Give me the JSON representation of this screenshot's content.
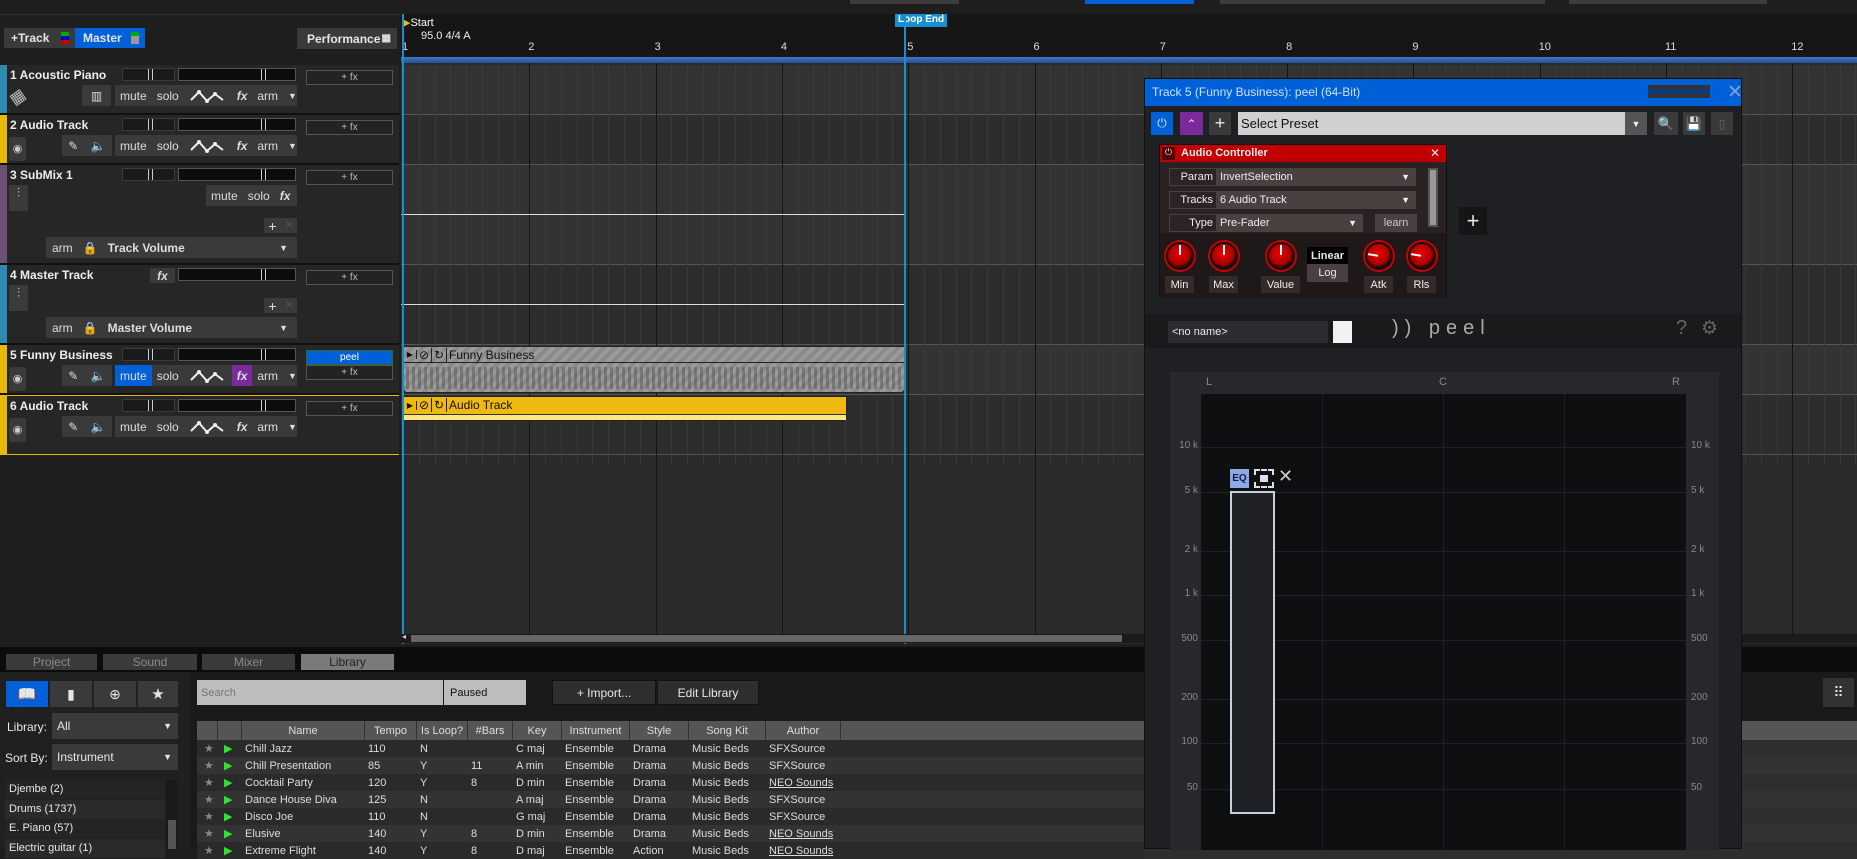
{
  "header": {
    "add_track": "+Track",
    "master": "Master",
    "performance": "Performance"
  },
  "colors": {
    "accent": "#0060d8",
    "track_blue": "#2e8bb0",
    "track_yellow": "#e8b80c",
    "track_purple": "#6b5075",
    "fx_purple": "#7a2a9a",
    "plugin_red": "#c00000"
  },
  "tracks": [
    {
      "name": "1 Acoustic Piano",
      "color": "#2e8bb0",
      "fx": "+ fx"
    },
    {
      "name": "2 Audio Track",
      "color": "#e8b80c",
      "fx": "+ fx"
    },
    {
      "name": "3 SubMix 1",
      "color": "#6b5075",
      "fx": "+ fx",
      "auto": "Track Volume"
    },
    {
      "name": "4 Master Track",
      "color": "#2e8bb0",
      "fx": "+ fx",
      "auto": "Master Volume"
    },
    {
      "name": "5 Funny Business",
      "color": "#e8b80c",
      "fx": "+ fx",
      "plugin": "peel"
    },
    {
      "name": "6 Audio Track",
      "color": "#e8b80c",
      "fx": "+ fx"
    }
  ],
  "controls": {
    "mute": "mute",
    "solo": "solo",
    "fx": "fx",
    "arm": "arm"
  },
  "ruler": {
    "start": "Start",
    "tempo": "95.0 4/4 A",
    "loop_end": "Loop End",
    "bars": [
      "1",
      "2",
      "3",
      "4",
      "5",
      "6",
      "7",
      "8",
      "9",
      "10",
      "11",
      "12"
    ]
  },
  "clips": [
    {
      "name": "Funny Business"
    },
    {
      "name": "Audio Track"
    }
  ],
  "bottom_tabs": [
    "Project",
    "Sound",
    "Mixer",
    "Library"
  ],
  "library": {
    "library_label": "Library:",
    "library_value": "All",
    "sort_label": "Sort By:",
    "sort_value": "Instrument",
    "categories": [
      "Djembe (2)",
      "Drums (1737)",
      "E. Piano (57)",
      "Electric guitar (1)"
    ],
    "search_placeholder": "Search",
    "status": "Paused",
    "import": "+ Import...",
    "edit": "Edit Library",
    "columns": [
      "",
      "",
      "Name",
      "Tempo",
      "Is Loop?",
      "#Bars",
      "Key",
      "Instrument",
      "Style",
      "Song Kit",
      "Author"
    ],
    "rows": [
      [
        "Chill Jazz",
        "110",
        "N",
        "",
        "C maj",
        "Ensemble",
        "Drama",
        "Music Beds",
        "SFXSource"
      ],
      [
        "Chill Presentation",
        "85",
        "Y",
        "11",
        "A min",
        "Ensemble",
        "Drama",
        "Music Beds",
        "SFXSource"
      ],
      [
        "Cocktail Party",
        "120",
        "Y",
        "8",
        "D min",
        "Ensemble",
        "Drama",
        "Music Beds",
        "NEO Sounds"
      ],
      [
        "Dance House Diva",
        "125",
        "N",
        "",
        "A maj",
        "Ensemble",
        "Drama",
        "Music Beds",
        "SFXSource"
      ],
      [
        "Disco Joe",
        "110",
        "N",
        "",
        "G maj",
        "Ensemble",
        "Drama",
        "Music Beds",
        "SFXSource"
      ],
      [
        "Elusive",
        "140",
        "Y",
        "8",
        "D min",
        "Ensemble",
        "Drama",
        "Music Beds",
        "NEO Sounds"
      ],
      [
        "Extreme Flight",
        "140",
        "Y",
        "8",
        "D maj",
        "Ensemble",
        "Action",
        "Music Beds",
        "NEO Sounds"
      ]
    ]
  },
  "plugin": {
    "title": "Track 5 (Funny Business): peel (64-Bit)",
    "preset": "Select Preset",
    "controller": {
      "title": "Audio Controller",
      "param_label": "Param",
      "param": "InvertSelection",
      "tracks_label": "Tracks",
      "tracks": "6 Audio Track",
      "type_label": "Type",
      "type": "Pre-Fader",
      "learn": "learn",
      "knobs": [
        "Min",
        "Max",
        "Value",
        "Atk",
        "Rls"
      ],
      "linear": "Linear",
      "log": "Log"
    },
    "name_field": "<no name>",
    "logo": "peel",
    "help": "?",
    "graph": {
      "top": [
        "L",
        "C",
        "R"
      ],
      "freqs": [
        "10 k",
        "5 k",
        "2 k",
        "1 k",
        "500",
        "200",
        "100",
        "50"
      ],
      "eq": "EQ"
    }
  }
}
